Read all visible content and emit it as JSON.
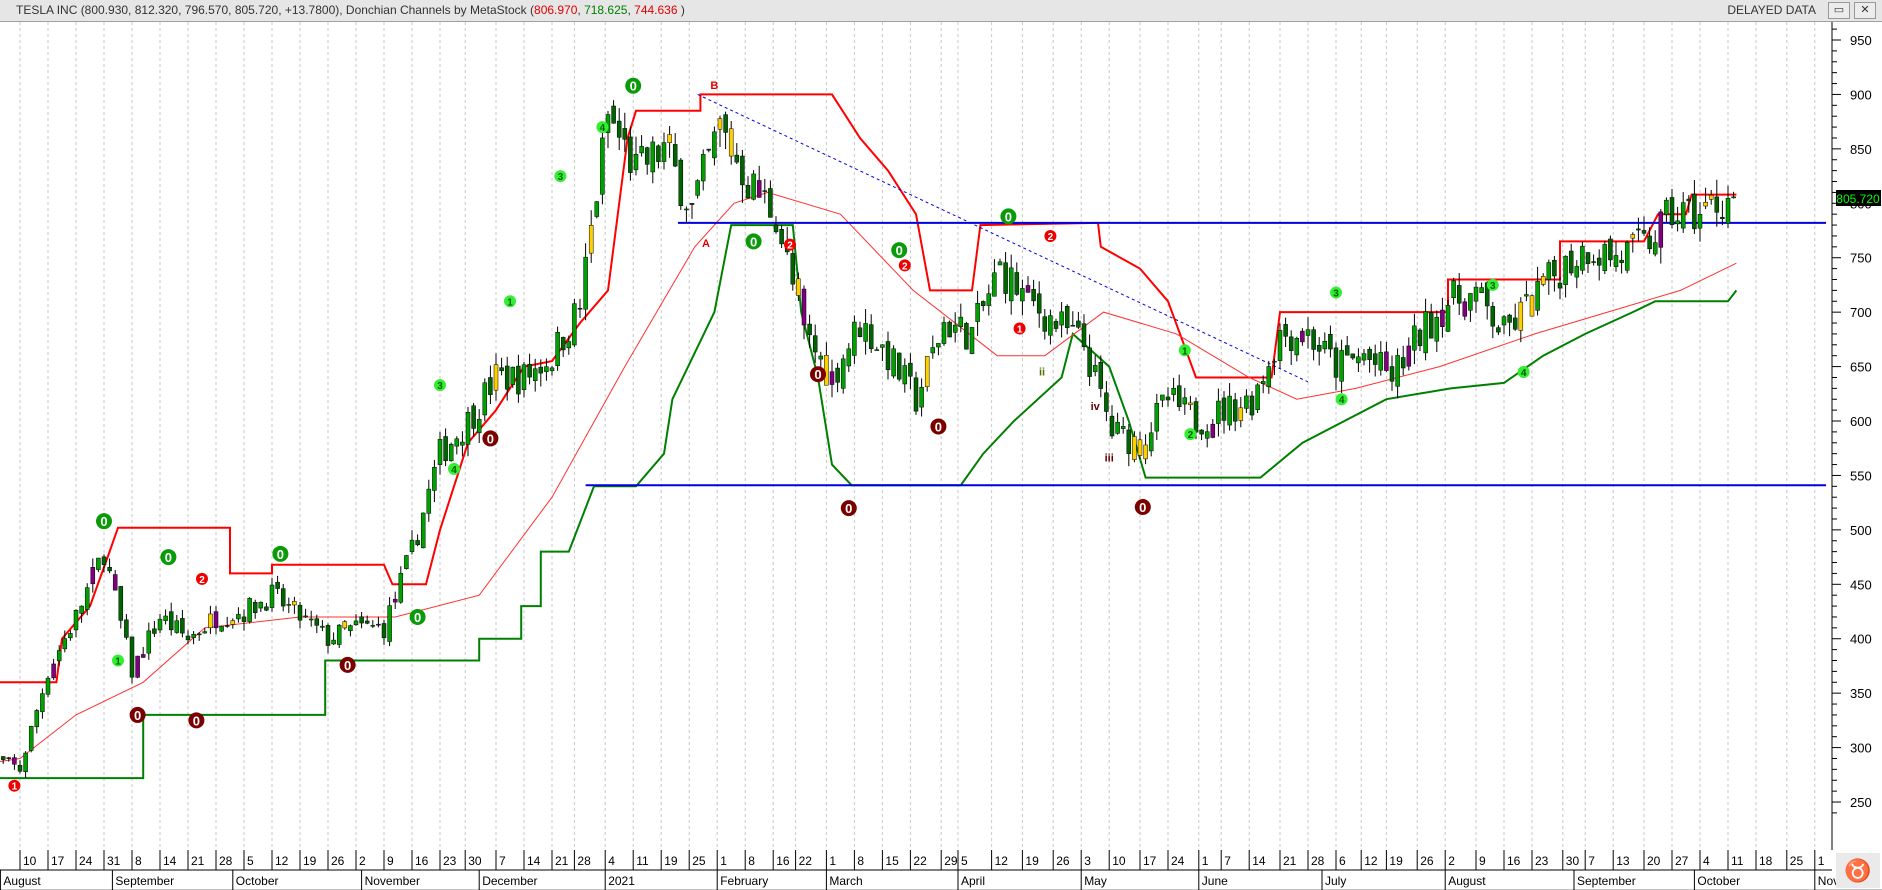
{
  "header": {
    "title_main": "TESLA INC (800.930, 812.320, 796.570, 805.720, +13.7800), Donchian Channels by MetaStock (",
    "upper": "806.970",
    "sep1": ", ",
    "middle": "718.625",
    "sep2": ", ",
    "lower": "744.636",
    "close_paren": " )",
    "delayed": "DELAYED DATA",
    "restore_icon": "restore-icon",
    "close_icon": "close-icon"
  },
  "last_price_label": "805.720",
  "colors": {
    "upper": "#ff0000",
    "lower": "#008000",
    "ma": "#ff3030",
    "hline": "#0000e0",
    "up": "#00a000",
    "down": "#006400"
  },
  "chart_data": {
    "type": "candlestick",
    "title": "TESLA INC daily with Donchian Channels by MetaStock",
    "x_unit": "weeks since 2020-08-10",
    "ylim": [
      230,
      965
    ],
    "y_ticks": [
      250,
      300,
      350,
      400,
      450,
      500,
      550,
      600,
      650,
      700,
      750,
      800,
      850,
      900,
      950
    ],
    "x_day_ticks": [
      {
        "t": 0,
        "label": "10"
      },
      {
        "t": 1,
        "label": "17"
      },
      {
        "t": 2,
        "label": "24"
      },
      {
        "t": 3,
        "label": "31"
      },
      {
        "t": 4,
        "label": "8"
      },
      {
        "t": 5,
        "label": "14"
      },
      {
        "t": 6,
        "label": "21"
      },
      {
        "t": 7,
        "label": "28"
      },
      {
        "t": 8,
        "label": "5"
      },
      {
        "t": 9,
        "label": "12"
      },
      {
        "t": 10,
        "label": "19"
      },
      {
        "t": 11,
        "label": "26"
      },
      {
        "t": 12,
        "label": "2"
      },
      {
        "t": 13,
        "label": "9"
      },
      {
        "t": 14,
        "label": "16"
      },
      {
        "t": 15,
        "label": "23"
      },
      {
        "t": 15.9,
        "label": "30"
      },
      {
        "t": 17,
        "label": "7"
      },
      {
        "t": 18,
        "label": "14"
      },
      {
        "t": 19,
        "label": "21"
      },
      {
        "t": 19.8,
        "label": "28"
      },
      {
        "t": 20.9,
        "label": "4"
      },
      {
        "t": 21.9,
        "label": "11"
      },
      {
        "t": 22.9,
        "label": "19"
      },
      {
        "t": 23.9,
        "label": "25"
      },
      {
        "t": 24.9,
        "label": "1"
      },
      {
        "t": 25.9,
        "label": "8"
      },
      {
        "t": 26.9,
        "label": "16"
      },
      {
        "t": 27.7,
        "label": "22"
      },
      {
        "t": 28.8,
        "label": "1"
      },
      {
        "t": 29.8,
        "label": "8"
      },
      {
        "t": 30.8,
        "label": "15"
      },
      {
        "t": 31.8,
        "label": "22"
      },
      {
        "t": 32.9,
        "label": "29"
      },
      {
        "t": 33.5,
        "label": "5"
      },
      {
        "t": 34.7,
        "label": "12"
      },
      {
        "t": 35.8,
        "label": "19"
      },
      {
        "t": 36.9,
        "label": "26"
      },
      {
        "t": 37.9,
        "label": "3"
      },
      {
        "t": 38.9,
        "label": "10"
      },
      {
        "t": 40,
        "label": "17"
      },
      {
        "t": 41,
        "label": "24"
      },
      {
        "t": 42.1,
        "label": "1"
      },
      {
        "t": 42.9,
        "label": "7"
      },
      {
        "t": 43.9,
        "label": "14"
      },
      {
        "t": 45,
        "label": "21"
      },
      {
        "t": 46,
        "label": "28"
      },
      {
        "t": 47,
        "label": "6"
      },
      {
        "t": 47.9,
        "label": "12"
      },
      {
        "t": 48.8,
        "label": "19"
      },
      {
        "t": 49.9,
        "label": "26"
      },
      {
        "t": 50.9,
        "label": "2"
      },
      {
        "t": 52,
        "label": "9"
      },
      {
        "t": 53,
        "label": "16"
      },
      {
        "t": 54,
        "label": "23"
      },
      {
        "t": 55.1,
        "label": "30"
      },
      {
        "t": 55.9,
        "label": "7"
      },
      {
        "t": 56.9,
        "label": "13"
      },
      {
        "t": 58,
        "label": "20"
      },
      {
        "t": 59,
        "label": "27"
      },
      {
        "t": 60,
        "label": "4"
      },
      {
        "t": 61,
        "label": "11"
      },
      {
        "t": 62,
        "label": "18"
      },
      {
        "t": 63.1,
        "label": "25"
      },
      {
        "t": 64.1,
        "label": "1"
      }
    ],
    "x_month_ticks": [
      {
        "t": -0.7,
        "label": "August"
      },
      {
        "t": 3.3,
        "label": "September"
      },
      {
        "t": 7.6,
        "label": "October"
      },
      {
        "t": 12.2,
        "label": "November"
      },
      {
        "t": 16.4,
        "label": "December"
      },
      {
        "t": 20.9,
        "label": "2021"
      },
      {
        "t": 24.9,
        "label": "February"
      },
      {
        "t": 28.8,
        "label": "March"
      },
      {
        "t": 33.5,
        "label": "April"
      },
      {
        "t": 37.9,
        "label": "May"
      },
      {
        "t": 42.1,
        "label": "June"
      },
      {
        "t": 46.5,
        "label": "July"
      },
      {
        "t": 50.9,
        "label": "August"
      },
      {
        "t": 55.5,
        "label": "September"
      },
      {
        "t": 59.8,
        "label": "October"
      },
      {
        "t": 64.1,
        "label": "November"
      }
    ],
    "weekly_close": [
      [
        -1,
        290
      ],
      [
        0,
        280
      ],
      [
        1,
        370
      ],
      [
        2,
        420
      ],
      [
        3,
        480
      ],
      [
        4,
        370
      ],
      [
        5,
        420
      ],
      [
        6,
        400
      ],
      [
        7,
        420
      ],
      [
        8,
        425
      ],
      [
        9,
        440
      ],
      [
        10,
        420
      ],
      [
        11,
        400
      ],
      [
        12,
        410
      ],
      [
        13,
        410
      ],
      [
        14,
        480
      ],
      [
        15,
        570
      ],
      [
        16,
        600
      ],
      [
        17,
        640
      ],
      [
        18,
        640
      ],
      [
        19,
        660
      ],
      [
        20,
        705
      ],
      [
        21,
        880
      ],
      [
        22,
        830
      ],
      [
        23,
        850
      ],
      [
        24,
        795
      ],
      [
        25,
        870
      ],
      [
        26,
        820
      ],
      [
        27,
        790
      ],
      [
        28,
        680
      ],
      [
        29,
        640
      ],
      [
        30,
        690
      ],
      [
        31,
        660
      ],
      [
        32,
        620
      ],
      [
        33,
        690
      ],
      [
        34,
        680
      ],
      [
        35,
        740
      ],
      [
        36,
        710
      ],
      [
        37,
        690
      ],
      [
        38,
        670
      ],
      [
        39,
        590
      ],
      [
        40,
        580
      ],
      [
        41,
        620
      ],
      [
        42,
        600
      ],
      [
        43,
        610
      ],
      [
        44,
        620
      ],
      [
        45,
        680
      ],
      [
        46,
        680
      ],
      [
        47,
        650
      ],
      [
        48,
        660
      ],
      [
        49,
        640
      ],
      [
        50,
        680
      ],
      [
        51,
        710
      ],
      [
        52,
        715
      ],
      [
        53,
        680
      ],
      [
        54,
        710
      ],
      [
        55,
        740
      ],
      [
        56,
        760
      ],
      [
        57,
        750
      ],
      [
        58,
        760
      ],
      [
        59,
        790
      ],
      [
        60,
        790
      ],
      [
        61,
        805
      ]
    ],
    "donchian_upper": [
      [
        -1.3,
        360
      ],
      [
        1.3,
        360
      ],
      [
        1.5,
        400
      ],
      [
        2.5,
        430
      ],
      [
        3.2,
        480
      ],
      [
        3.5,
        502
      ],
      [
        7.5,
        502
      ],
      [
        7.5,
        460
      ],
      [
        9,
        460
      ],
      [
        9,
        468
      ],
      [
        13,
        468
      ],
      [
        13.3,
        450
      ],
      [
        14.5,
        450
      ],
      [
        15,
        500
      ],
      [
        16,
        580
      ],
      [
        17,
        610
      ],
      [
        18,
        650
      ],
      [
        19,
        655
      ],
      [
        20,
        690
      ],
      [
        21,
        720
      ],
      [
        21.7,
        860
      ],
      [
        22,
        885
      ],
      [
        24.3,
        885
      ],
      [
        24.3,
        900
      ],
      [
        29,
        900
      ],
      [
        30,
        860
      ],
      [
        31,
        830
      ],
      [
        32,
        790
      ],
      [
        32.5,
        720
      ],
      [
        34,
        720
      ],
      [
        34.3,
        780
      ],
      [
        38.5,
        782
      ],
      [
        38.6,
        760
      ],
      [
        40,
        740
      ],
      [
        41,
        710
      ],
      [
        42,
        640
      ],
      [
        44.7,
        640
      ],
      [
        45,
        700
      ],
      [
        51,
        700
      ],
      [
        51,
        730
      ],
      [
        55,
        730
      ],
      [
        55,
        765
      ],
      [
        58,
        765
      ],
      [
        58.5,
        790
      ],
      [
        59.5,
        790
      ],
      [
        59.7,
        808
      ],
      [
        61.3,
        808
      ]
    ],
    "donchian_lower": [
      [
        -1.3,
        260
      ],
      [
        -0.8,
        272
      ],
      [
        4.4,
        272
      ],
      [
        4.4,
        330
      ],
      [
        10.9,
        330
      ],
      [
        10.9,
        380
      ],
      [
        16.4,
        380
      ],
      [
        16.4,
        400
      ],
      [
        17.9,
        400
      ],
      [
        17.9,
        430
      ],
      [
        18.6,
        430
      ],
      [
        18.6,
        480
      ],
      [
        19.6,
        480
      ],
      [
        20.5,
        540
      ],
      [
        22,
        540
      ],
      [
        23,
        570
      ],
      [
        23.3,
        620
      ],
      [
        24.8,
        700
      ],
      [
        25.4,
        780
      ],
      [
        27.6,
        780
      ],
      [
        27.9,
        700
      ],
      [
        28.5,
        640
      ],
      [
        29,
        560
      ],
      [
        29.7,
        541
      ],
      [
        33.6,
        541
      ],
      [
        34.4,
        570
      ],
      [
        35.5,
        600
      ],
      [
        37.2,
        640
      ],
      [
        37.6,
        680
      ],
      [
        38.9,
        650
      ],
      [
        39.6,
        600
      ],
      [
        40.2,
        548
      ],
      [
        44.3,
        548
      ],
      [
        45.8,
        580
      ],
      [
        47.3,
        600
      ],
      [
        48.8,
        620
      ],
      [
        51.1,
        630
      ],
      [
        53,
        635
      ],
      [
        54.4,
        660
      ],
      [
        55.9,
        680
      ],
      [
        57.6,
        700
      ],
      [
        58.4,
        710
      ],
      [
        61,
        710
      ],
      [
        61.3,
        720
      ]
    ],
    "moving_average": [
      [
        -1.3,
        285
      ],
      [
        0,
        290
      ],
      [
        2,
        330
      ],
      [
        4.4,
        360
      ],
      [
        6.6,
        410
      ],
      [
        10,
        420
      ],
      [
        13.4,
        420
      ],
      [
        16.4,
        440
      ],
      [
        19,
        530
      ],
      [
        21.6,
        650
      ],
      [
        24.1,
        760
      ],
      [
        25.5,
        800
      ],
      [
        26.7,
        810
      ],
      [
        29.3,
        790
      ],
      [
        31.9,
        720
      ],
      [
        34.9,
        660
      ],
      [
        36.6,
        660
      ],
      [
        38.7,
        700
      ],
      [
        41.3,
        680
      ],
      [
        43.9,
        640
      ],
      [
        45.6,
        620
      ],
      [
        47.7,
        630
      ],
      [
        50.7,
        650
      ],
      [
        54.1,
        680
      ],
      [
        56.7,
        700
      ],
      [
        59.3,
        720
      ],
      [
        61.3,
        745
      ]
    ],
    "horizontal_lines": [
      {
        "value": 782,
        "from": 23.5,
        "to": 64.5
      },
      {
        "value": 541,
        "from": 20.2,
        "to": 64.5
      }
    ],
    "trendline": {
      "from": [
        24.2,
        900
      ],
      "to": [
        46,
        636
      ]
    },
    "annotations": [
      {
        "t": 3,
        "p": 508,
        "text": "0",
        "kind": "top"
      },
      {
        "t": 4.2,
        "p": 330,
        "text": "0",
        "kind": "bottom"
      },
      {
        "t": 5.3,
        "p": 475,
        "text": "0",
        "kind": "top"
      },
      {
        "t": 6.3,
        "p": 325,
        "text": "0",
        "kind": "bottom"
      },
      {
        "t": 9.3,
        "p": 478,
        "text": "0",
        "kind": "top"
      },
      {
        "t": 11.7,
        "p": 376,
        "text": "0",
        "kind": "bottom"
      },
      {
        "t": 14.2,
        "p": 420,
        "text": "0",
        "kind": "top"
      },
      {
        "t": 16.8,
        "p": 584,
        "text": "0",
        "kind": "bottom"
      },
      {
        "t": 21.9,
        "p": 908,
        "text": "0",
        "kind": "top"
      },
      {
        "t": 26.2,
        "p": 765,
        "text": "0",
        "kind": "top"
      },
      {
        "t": 28.5,
        "p": 643,
        "text": "0",
        "kind": "bottom"
      },
      {
        "t": 29.6,
        "p": 520,
        "text": "0",
        "kind": "bottom"
      },
      {
        "t": 31.4,
        "p": 757,
        "text": "0",
        "kind": "top"
      },
      {
        "t": 32.8,
        "p": 595,
        "text": "0",
        "kind": "bottom"
      },
      {
        "t": 35.3,
        "p": 788,
        "text": "0",
        "kind": "top"
      },
      {
        "t": 40.1,
        "p": 521,
        "text": "0",
        "kind": "bottom"
      },
      {
        "t": -0.2,
        "p": 265,
        "text": "1",
        "kind": "red"
      },
      {
        "t": 3.5,
        "p": 380,
        "text": "1",
        "kind": "lime"
      },
      {
        "t": 6.5,
        "p": 455,
        "text": "2",
        "kind": "red"
      },
      {
        "t": 15,
        "p": 633,
        "text": "3",
        "kind": "lime"
      },
      {
        "t": 15.5,
        "p": 556,
        "text": "4",
        "kind": "lime"
      },
      {
        "t": 17.5,
        "p": 710,
        "text": "1",
        "kind": "lime"
      },
      {
        "t": 19.3,
        "p": 825,
        "text": "3",
        "kind": "lime"
      },
      {
        "t": 20.8,
        "p": 870,
        "text": "4",
        "kind": "lime"
      },
      {
        "t": 27.5,
        "p": 762,
        "text": "2",
        "kind": "red"
      },
      {
        "t": 31.6,
        "p": 743,
        "text": "2",
        "kind": "red"
      },
      {
        "t": 36.8,
        "p": 770,
        "text": "2",
        "kind": "red"
      },
      {
        "t": 35.7,
        "p": 685,
        "text": "1",
        "kind": "red"
      },
      {
        "t": 41.6,
        "p": 665,
        "text": "1",
        "kind": "lime"
      },
      {
        "t": 41.8,
        "p": 588,
        "text": "2",
        "kind": "lime"
      },
      {
        "t": 47,
        "p": 718,
        "text": "3",
        "kind": "lime"
      },
      {
        "t": 47.2,
        "p": 620,
        "text": "4",
        "kind": "lime"
      },
      {
        "t": 52.6,
        "p": 725,
        "text": "3",
        "kind": "lime"
      },
      {
        "t": 53.7,
        "p": 645,
        "text": "4",
        "kind": "lime"
      },
      {
        "t": 24.8,
        "p": 905,
        "text": "B",
        "kind": "label-red"
      },
      {
        "t": 24.5,
        "p": 760,
        "text": "A",
        "kind": "label-red"
      },
      {
        "t": 38.4,
        "p": 610,
        "text": "iv",
        "kind": "label-dark"
      },
      {
        "t": 38.9,
        "p": 563,
        "text": "iii",
        "kind": "label-dark"
      },
      {
        "t": 36.5,
        "p": 642,
        "text": "ii",
        "kind": "label-olive"
      }
    ]
  }
}
